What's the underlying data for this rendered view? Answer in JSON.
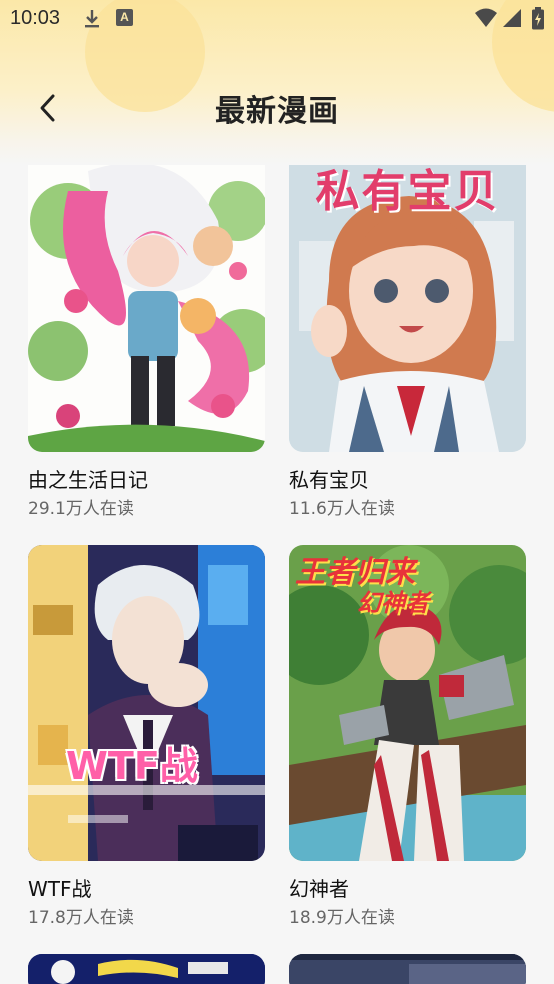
{
  "status_bar": {
    "time": "10:03",
    "icons": [
      "download-icon",
      "a-notification-icon",
      "wifi-icon",
      "signal-icon",
      "battery-charging-icon"
    ]
  },
  "header": {
    "title": "最新漫画",
    "back_icon": "chevron-left-icon"
  },
  "comics": [
    {
      "title": "由之生活日记",
      "readers": "29.1万人在读"
    },
    {
      "title": "私有宝贝",
      "readers": "11.6万人在读",
      "cover_text": "私有宝贝"
    },
    {
      "title": "WTF战",
      "readers": "17.8万人在读",
      "cover_text": "WTF战"
    },
    {
      "title": "幻神者",
      "readers": "18.9万人在读",
      "cover_text": "王者归来",
      "cover_text2": "幻神者"
    }
  ],
  "colors": {
    "header_yellow": "#fbe8a8",
    "background": "#f6f6f6",
    "subtitle_gray": "#666666"
  }
}
